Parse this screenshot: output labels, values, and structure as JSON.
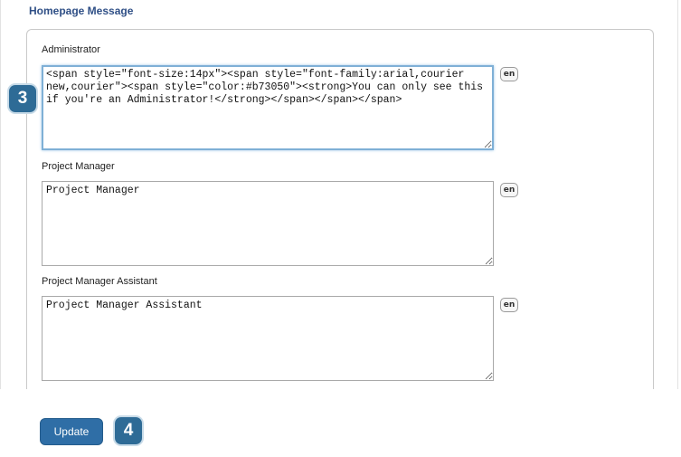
{
  "section": {
    "title": "Homepage Message"
  },
  "fields": [
    {
      "label": "Administrator",
      "value": "<span style=\"font-size:14px\"><span style=\"font-family:arial,courier new,courier\"><span style=\"color:#b73050\"><strong>You can only see this if you're an Administrator!</strong></span></span></span>",
      "lang": "en"
    },
    {
      "label": "Project Manager",
      "value": "Project Manager",
      "lang": "en"
    },
    {
      "label": "Project Manager Assistant",
      "value": "Project Manager Assistant",
      "lang": "en"
    }
  ],
  "badges": {
    "step_a": "3",
    "step_b": "4"
  },
  "actions": {
    "update_label": "Update"
  },
  "colors": {
    "accent": "#2f6ea6",
    "badge": "#2e6b96",
    "focus": "#7fb0d6",
    "title": "#2f4f86"
  }
}
